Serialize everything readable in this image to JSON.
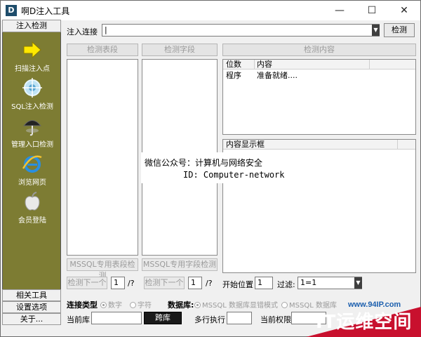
{
  "window": {
    "title": "啊D注入工具",
    "app_icon_letter": "D",
    "minimize_glyph": "—",
    "maximize_glyph": "☐",
    "close_glyph": "✕"
  },
  "nav": {
    "header": "注入检测",
    "panel_color": "#7d7c33",
    "items": [
      {
        "label": "扫描注入点",
        "icon": "arrow-right-icon"
      },
      {
        "label": "SQL注入检测",
        "icon": "target-icon"
      },
      {
        "label": "管理入口检测",
        "icon": "umbrella-icon"
      },
      {
        "label": "浏览网页",
        "icon": "ie-browser-icon"
      },
      {
        "label": "会员登陆",
        "icon": "apple-icon"
      }
    ],
    "bottom": [
      "相关工具",
      "设置选项",
      "关于..."
    ]
  },
  "toolbar": {
    "inject_label": "注入连接",
    "url_value": "|",
    "check_button": "检测"
  },
  "columns": {
    "tables_header": "检测表段",
    "fields_header": "检测字段",
    "content_header": "检测内容",
    "mssql_tables_button": "MSSQL专用表段检测",
    "mssql_fields_button": "MSSQL专用字段检测",
    "next_tables_button": "检测下一个",
    "next_fields_button": "检测下一个",
    "tables_page": "1",
    "fields_page": "1",
    "page_suffix": "/?"
  },
  "result_grid": {
    "headers": [
      "位数",
      "内容"
    ],
    "rows": [
      {
        "pos": "程序",
        "content": "准备就绪...."
      }
    ]
  },
  "content_box": {
    "header": "内容显示框"
  },
  "watermark": {
    "line1": "微信公众号：计算机与网络安全",
    "line2": "ID: Computer-network"
  },
  "options": {
    "start_pos_label": "开始位置",
    "start_pos_value": "1",
    "filter_label": "过滤:",
    "filter_value": "1=1",
    "conn_type_label": "连接类型",
    "conn_type_options": [
      {
        "label": "数字",
        "selected": true
      },
      {
        "label": "字符",
        "selected": false
      }
    ],
    "db_label": "数据库:",
    "db_options": [
      {
        "label": "MSSQL 数据库显错模式",
        "selected": true
      },
      {
        "label": "MSSQL 数据库",
        "selected": false
      }
    ],
    "current_db_label": "当前库",
    "current_db_value": "",
    "jump_db_button": "跨库",
    "multi_exec_label": "多行执行",
    "multi_exec_value": "",
    "current_perm_label": "当前权限"
  },
  "branding": {
    "site": "www.94IP.com",
    "logo": "IT运维空间",
    "logo_color": "#c8102e"
  }
}
